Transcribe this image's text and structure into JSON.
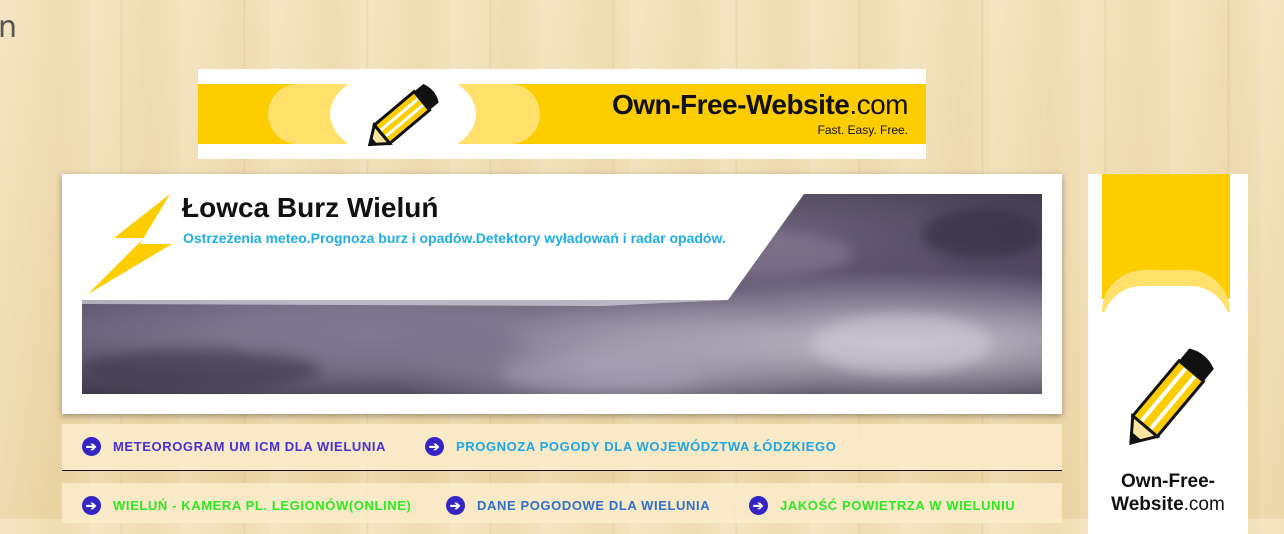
{
  "corner_text": "n",
  "top_ad": {
    "brand": "Own-Free-Website",
    "brand_suffix": ".com",
    "tagline": "Fast. Easy. Free."
  },
  "site": {
    "title": "Łowca Burz Wieluń",
    "subtitle": "Ostrzeżenia meteo.Prognoza burz i opadów.Detektory wyładowań i radar opadów."
  },
  "nav": {
    "row1": [
      {
        "label": "METEOROGRAM UM ICM DLA WIELUNIA",
        "color": "#4b2fd6"
      },
      {
        "label": "PROGNOZA POGODY DLA WOJEWÓDZTWA ŁÓDZKIEGO",
        "color": "#1ea5e6"
      }
    ],
    "row2": [
      {
        "label": "WIELUŃ - KAMERA PL. LEGIONÓW(ONLINE)",
        "color": "#2ee822"
      },
      {
        "label": "DANE POGODOWE DLA WIELUNIA",
        "color": "#2f70c8"
      },
      {
        "label": "JAKOŚĆ POWIETRZA W WIELUNIU",
        "color": "#2ee822"
      }
    ]
  },
  "side_ad": {
    "brand_line1": "Own-Free-",
    "brand_line2": "Website",
    "brand_suffix": ".com"
  },
  "colors": {
    "ad_yellow": "#fecd00",
    "arrow": "#3424c4",
    "bolt": "#fecd00"
  },
  "icons": {
    "pencil": "pencil-icon",
    "bolt": "lightning-bolt-icon",
    "nav_arrow": "arrow-right-circle-icon"
  }
}
